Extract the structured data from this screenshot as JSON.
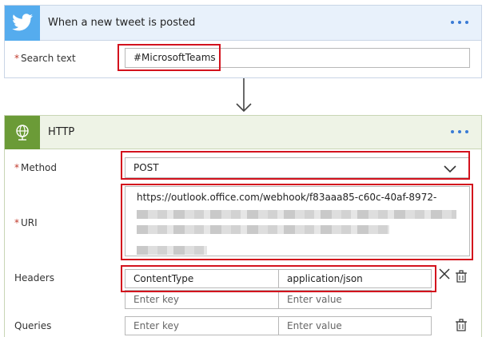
{
  "trigger": {
    "title": "When a new tweet is posted",
    "search_label": "Search text",
    "search_value": "#MicrosoftTeams"
  },
  "action": {
    "title": "HTTP",
    "method_label": "Method",
    "method_value": "POST",
    "uri_label": "URI",
    "uri_value": "https://outlook.office.com/webhook/f83aaa85-c60c-40af-8972-",
    "headers_label": "Headers",
    "headers": {
      "key": "ContentType",
      "value": "application/json",
      "new_key_placeholder": "Enter key",
      "new_value_placeholder": "Enter value"
    },
    "queries_label": "Queries",
    "queries": {
      "key_placeholder": "Enter key",
      "value_placeholder": "Enter value"
    }
  },
  "colors": {
    "twitter": "#55acee",
    "http": "#6b9b37",
    "highlight": "#d3121d",
    "required": "#c0392b",
    "more_dots": "#3a7bd5"
  },
  "icons": [
    "twitter-icon",
    "globe-icon",
    "more-icon",
    "chevron-down-icon",
    "down-arrow-icon",
    "close-icon",
    "delete-icon"
  ]
}
